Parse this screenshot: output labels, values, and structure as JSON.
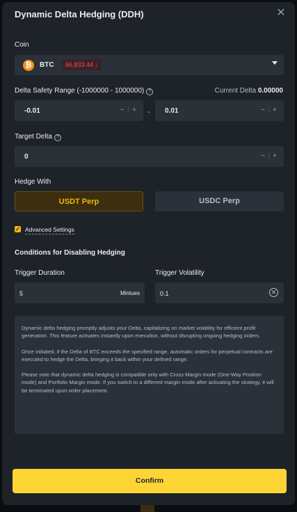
{
  "modal": {
    "title": "Dynamic Delta Hedging (DDH)",
    "close_icon": "close-icon"
  },
  "coin": {
    "label": "Coin",
    "name": "BTC",
    "icon_glyph": "₿",
    "price": "66,833.44 ↓",
    "price_color": "#f6465d"
  },
  "delta_range": {
    "label": "Delta Safety Range (-1000000 - 1000000)",
    "current_label": "Current Delta",
    "current_value": "0.00000",
    "min_value": "-0.01",
    "max_value": "0.01",
    "separator": "-"
  },
  "target_delta": {
    "label": "Target Delta",
    "value": "0"
  },
  "hedge_with": {
    "label": "Hedge With",
    "options": [
      "USDT Perp",
      "USDC Perp"
    ],
    "selected": "USDT Perp"
  },
  "advanced": {
    "label": "Advanced Settings",
    "checked": true
  },
  "conditions": {
    "title": "Conditions for Disabling Hedging",
    "trigger_duration_label": "Trigger Duration",
    "trigger_duration_value": "5",
    "trigger_duration_unit": "Mintues",
    "trigger_volatility_label": "Trigger Volatility",
    "trigger_volatility_value": "0.1"
  },
  "note": {
    "p1": "Dynamic delta hedging promptly adjusts your Delta, capitalizing on market volatility for efficient profit generation. This feature activates instantly upon execution, without disrupting ongoing hedging orders.",
    "p2": "Once initiated, if the Delta of BTC exceeds the specified range, automatic orders for perpetual contracts are executed to hedge the Delta, bringing it back within your defined range.",
    "p3": "Please note that dynamic delta hedging is compatible only with Cross Margin mode (One-Way Position mode) and Portfolio Margin mode. If you switch to a different margin mode after activating the strategy, it will be terminated upon order placement."
  },
  "confirm_label": "Confirm",
  "colors": {
    "accent": "#f0b90b",
    "confirm_bg": "#fcd535",
    "panel": "#1e2329",
    "field": "#2b3139"
  }
}
